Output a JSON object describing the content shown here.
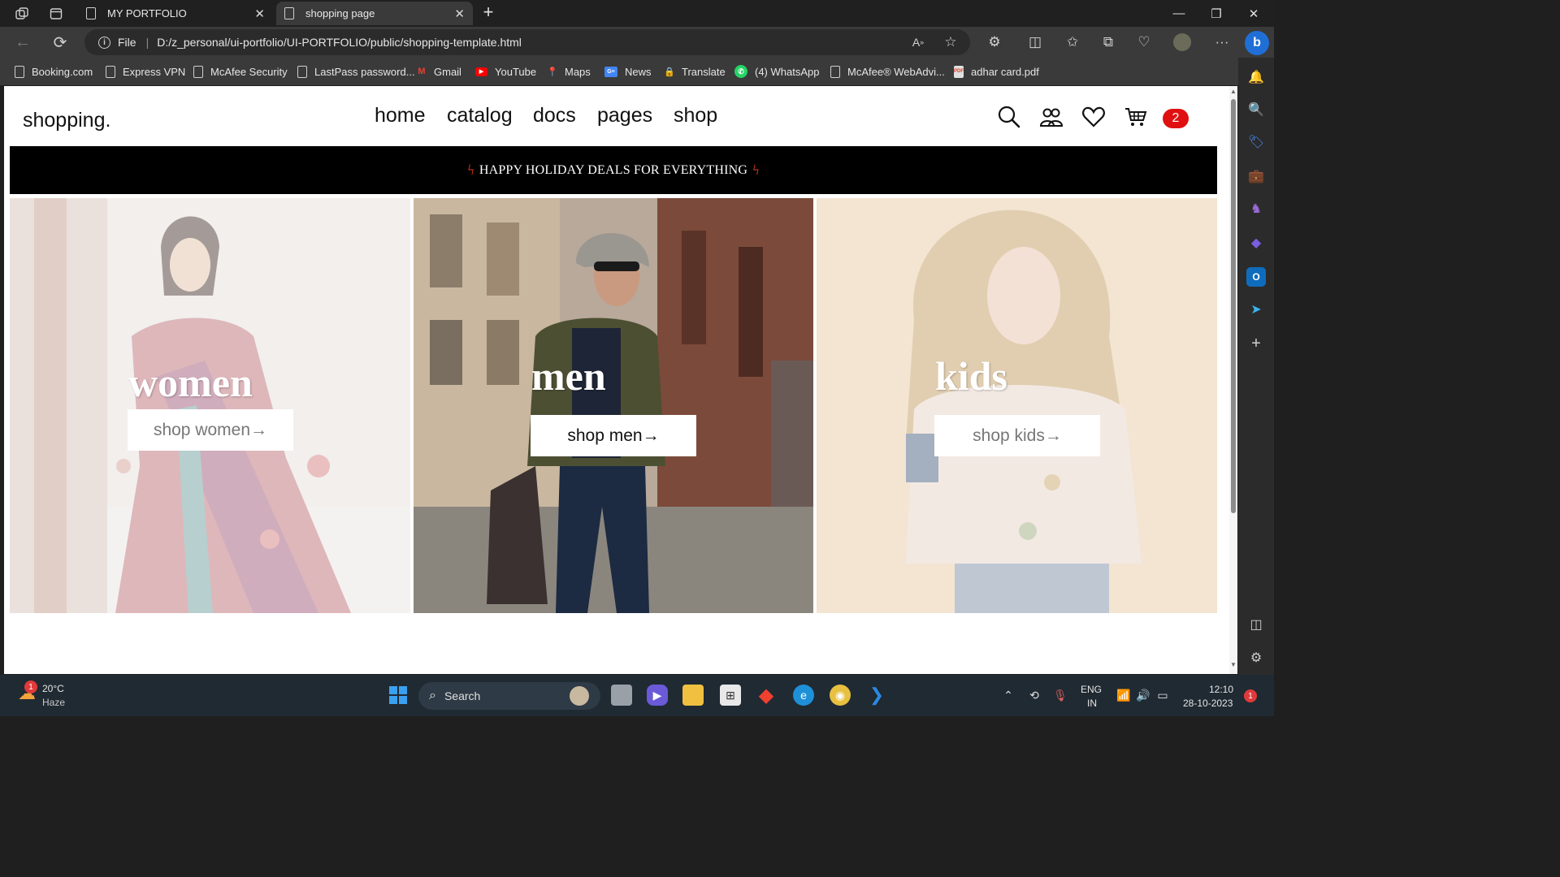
{
  "browser": {
    "tabs": [
      {
        "title": "MY PORTFOLIO",
        "active": false
      },
      {
        "title": "shopping page",
        "active": true
      }
    ],
    "address": {
      "scheme_label": "File",
      "url": "D:/z_personal/ui-portfolio/UI-PORTFOLIO/public/shopping-template.html"
    },
    "bookmarks": [
      {
        "label": "Booking.com",
        "icon": "page-icon"
      },
      {
        "label": "Express VPN",
        "icon": "page-icon"
      },
      {
        "label": "McAfee Security",
        "icon": "page-icon"
      },
      {
        "label": "LastPass password...",
        "icon": "page-icon"
      },
      {
        "label": "Gmail",
        "icon": "gmail-icon"
      },
      {
        "label": "YouTube",
        "icon": "youtube-icon"
      },
      {
        "label": "Maps",
        "icon": "maps-icon"
      },
      {
        "label": "News",
        "icon": "news-icon"
      },
      {
        "label": "Translate",
        "icon": "translate-icon"
      },
      {
        "label": "(4) WhatsApp",
        "icon": "whatsapp-icon"
      },
      {
        "label": "McAfee® WebAdvi...",
        "icon": "page-icon"
      },
      {
        "label": "adhar card.pdf",
        "icon": "pdf-icon"
      }
    ]
  },
  "site": {
    "logo": "shopping.",
    "nav": [
      "home",
      "catalog",
      "docs",
      "pages",
      "shop"
    ],
    "cart_count": "2",
    "banner": "HAPPY HOLIDAY DEALS FOR EVERYTHING",
    "panels": [
      {
        "title": "women",
        "button": "shop women→"
      },
      {
        "title": "men",
        "button": "shop men→"
      },
      {
        "title": "kids",
        "button": "shop kids→"
      }
    ]
  },
  "taskbar": {
    "weather_temp": "20°C",
    "weather_desc": "Haze",
    "weather_badge": "1",
    "search_label": "Search",
    "lang_top": "ENG",
    "lang_bottom": "IN",
    "time": "12:10",
    "date": "28-10-2023",
    "notification_count": "1"
  },
  "colors": {
    "accent_badge": "#e01010",
    "banner_bg": "#000000",
    "bolt": "#e8431c"
  }
}
